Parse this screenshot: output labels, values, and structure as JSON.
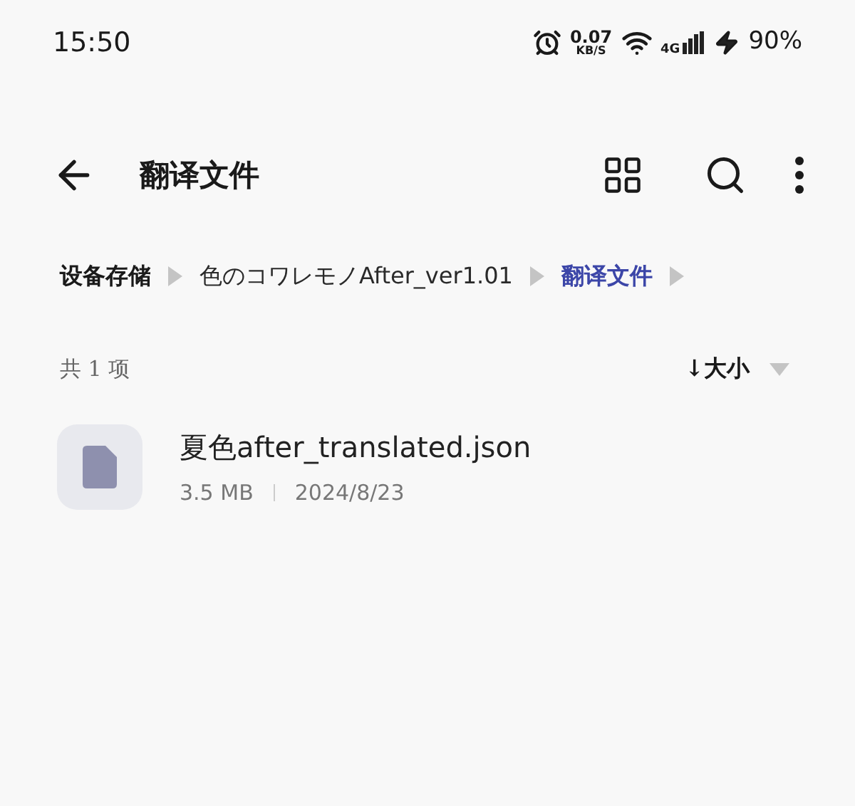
{
  "status_bar": {
    "time": "15:50",
    "speed": "0.07",
    "speed_unit": "KB/S",
    "network": "4G",
    "battery": "90%"
  },
  "toolbar": {
    "title": "翻译文件"
  },
  "breadcrumb": [
    {
      "label": "设备存储",
      "selected": false
    },
    {
      "label": "色のコワレモノAfter_ver1.01",
      "selected": false
    },
    {
      "label": "翻译文件",
      "selected": true
    }
  ],
  "list_header": {
    "count": "共 1 项",
    "sort": "↓大小"
  },
  "files": [
    {
      "name": "夏色after_translated.json",
      "size": "3.5 MB",
      "date": "2024/8/23"
    }
  ]
}
